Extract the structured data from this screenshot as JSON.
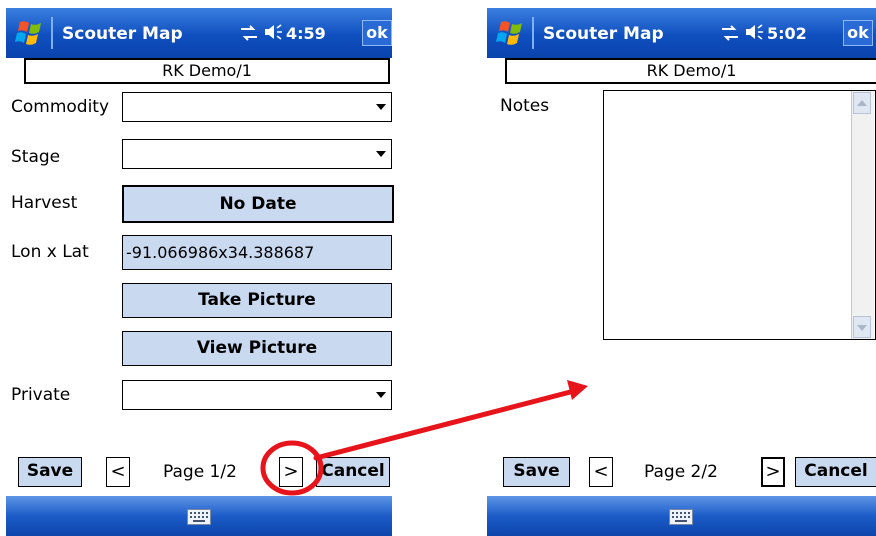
{
  "left_screen": {
    "title": "Scouter Map",
    "time": "4:59",
    "ok_label": "ok",
    "record": "RK Demo/1",
    "commodity_label": "Commodity",
    "stage_label": "Stage",
    "harvest_label": "Harvest",
    "harvest_button": "No Date",
    "lonlat_label": "Lon x Lat",
    "lonlat_value": "-91.066986x34.388687",
    "take_picture": "Take Picture",
    "view_picture": "View Picture",
    "private_label": "Private",
    "save_label": "Save",
    "prev_label": "<",
    "page": "Page 1/2",
    "next_label": ">",
    "cancel_label": "Cancel"
  },
  "right_screen": {
    "title": "Scouter Map",
    "time": "5:02",
    "ok_label": "ok",
    "record": "RK Demo/1",
    "notes_label": "Notes",
    "save_label": "Save",
    "prev_label": "<",
    "page": "Page 2/2",
    "next_label": ">",
    "cancel_label": "Cancel"
  },
  "colors": {
    "titlebar": "#0f4fbf",
    "button_fill": "#c9d9ef",
    "annotation": "#e8141c"
  },
  "icons": [
    "windows-flag-icon",
    "connectivity-icon",
    "volume-icon",
    "keyboard-icon",
    "dropdown-arrow-icon",
    "scroll-up-icon",
    "scroll-down-icon"
  ]
}
